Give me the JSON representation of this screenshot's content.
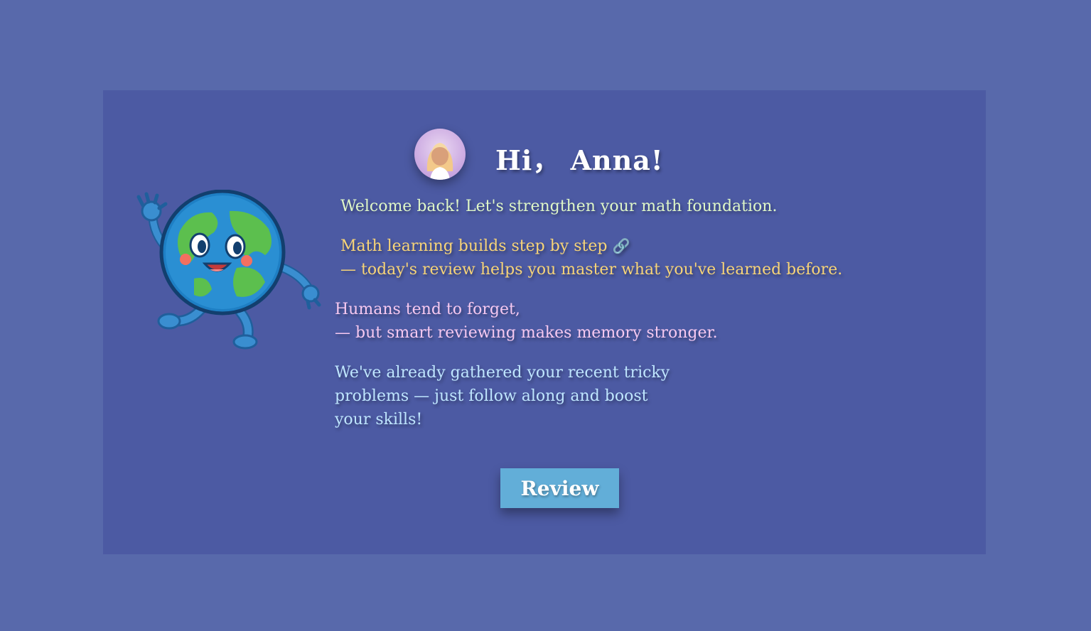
{
  "greeting": {
    "text": "Hi， Anna!"
  },
  "messages": {
    "welcome": "Welcome back! Let's strengthen your math foundation.",
    "math_line1": "Math learning builds step by step",
    "math_icon": "🔗",
    "math_line2": "— today's review helps you master what you've learned before.",
    "humans_line1": "Humans tend to forget,",
    "humans_line2": "— but smart reviewing makes memory stronger.",
    "gathered_line1": "We've already gathered your recent tricky",
    "gathered_line2": "problems — just follow along and boost",
    "gathered_line3": "your skills!"
  },
  "actions": {
    "review_label": "Review"
  },
  "icons": {
    "avatar": "girl-avatar-icon",
    "mascot": "earth-mascot-icon",
    "link": "link-icon"
  },
  "colors": {
    "background": "#5869ab",
    "panel": "#4c5aa3",
    "welcome_text": "#dff7c8",
    "math_text": "#f7d478",
    "humans_text": "#f6c9f1",
    "gathered_text": "#bfe6ff",
    "button": "#62aed8"
  }
}
